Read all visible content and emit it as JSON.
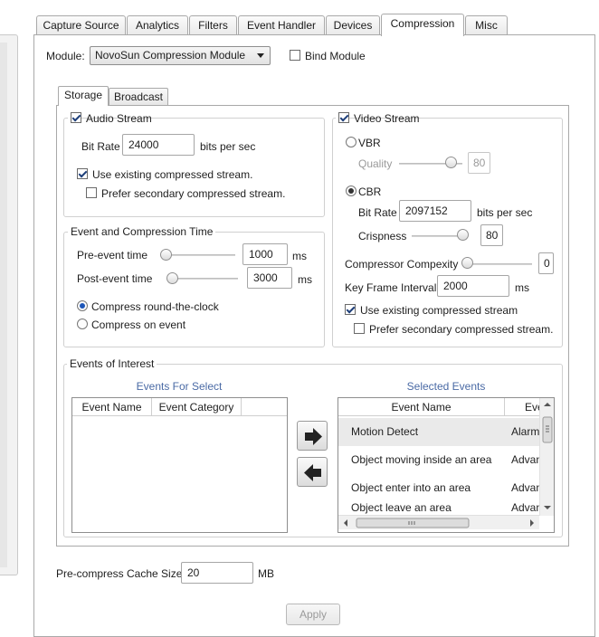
{
  "tabs": [
    {
      "label": "Capture Source"
    },
    {
      "label": "Analytics"
    },
    {
      "label": "Filters"
    },
    {
      "label": "Event Handler"
    },
    {
      "label": "Devices"
    },
    {
      "label": "Compression"
    },
    {
      "label": "Misc"
    }
  ],
  "active_tab": "Compression",
  "module": {
    "label": "Module:",
    "selected": "NovoSun Compression Module",
    "bind_label": "Bind Module",
    "bind_checked": false
  },
  "subtabs": [
    {
      "label": "Storage"
    },
    {
      "label": "Broadcast"
    }
  ],
  "audio_stream": {
    "title": "Audio Stream",
    "checked": true,
    "bitrate_label": "Bit Rate",
    "bitrate_value": "24000",
    "bitrate_unit": "bits per sec",
    "use_existing_label": "Use existing compressed stream.",
    "use_existing_checked": true,
    "prefer_secondary_label": "Prefer secondary compressed stream.",
    "prefer_secondary_checked": false
  },
  "video_stream": {
    "title": "Video Stream",
    "checked": true,
    "vbr_label": "VBR",
    "quality_label": "Quality",
    "quality_value": "80",
    "cbr_label": "CBR",
    "cbr_selected": true,
    "bitrate_label": "Bit Rate",
    "bitrate_value": "2097152",
    "bitrate_unit": "bits per sec",
    "crispness_label": "Crispness",
    "crispness_value": "80",
    "complexity_label": "Compressor Compexity",
    "complexity_value": "0",
    "keyframe_label": "Key Frame Interval",
    "keyframe_value": "2000",
    "keyframe_unit": "ms",
    "use_existing_label": "Use existing compressed stream",
    "use_existing_checked": true,
    "prefer_secondary_label": "Prefer secondary compressed stream.",
    "prefer_secondary_checked": false
  },
  "event_compression": {
    "title": "Event and Compression Time",
    "pre_label": "Pre-event time",
    "pre_value": "1000",
    "pre_unit": "ms",
    "post_label": "Post-event time",
    "post_value": "3000",
    "post_unit": "ms",
    "round_clock_label": "Compress round-the-clock",
    "on_event_label": "Compress on event",
    "selected_mode": "round-the-clock"
  },
  "events_of_interest": {
    "title": "Events of Interest",
    "for_select_title": "Events For Select",
    "for_select_columns": [
      "Event Name",
      "Event Category"
    ],
    "selected_title": "Selected Events",
    "selected_columns": [
      "Event Name",
      "Eve"
    ],
    "selected_rows": [
      {
        "name": "Motion Detect",
        "category": "Alarm"
      },
      {
        "name": "Object moving inside an area",
        "category": "Advan"
      },
      {
        "name": "Object enter into an area",
        "category": "Advan"
      },
      {
        "name": "Object leave an area",
        "category": "Advan"
      }
    ],
    "selected_index": 0
  },
  "cache": {
    "label": "Pre-compress Cache Size",
    "value": "20",
    "unit": "MB"
  },
  "apply_label": "Apply"
}
